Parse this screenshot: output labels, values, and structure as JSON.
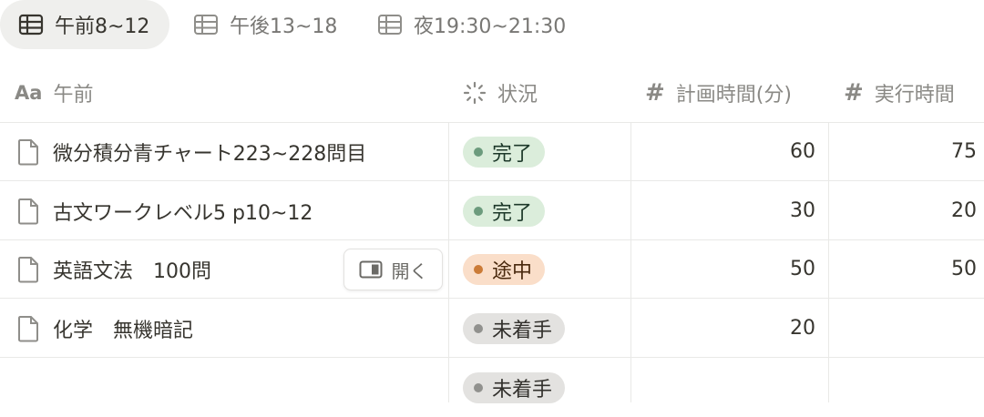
{
  "tabs": [
    {
      "label": "午前8~12",
      "active": true,
      "icon": "table-icon"
    },
    {
      "label": "午後13~18",
      "active": false,
      "icon": "table-icon"
    },
    {
      "label": "夜19:30~21:30",
      "active": false,
      "icon": "table-icon"
    }
  ],
  "columns": {
    "title": {
      "label": "午前",
      "icon_text": "Aa"
    },
    "status": {
      "label": "状況",
      "icon": "status-spinner-icon"
    },
    "planned": {
      "label": "計画時間(分)",
      "icon_text": "#"
    },
    "actual": {
      "label": "実行時間",
      "icon_text": "#"
    }
  },
  "rows": [
    {
      "title": "微分積分青チャート223~228問目",
      "status": "完了",
      "status_kind": "done",
      "planned": "60",
      "actual": "75"
    },
    {
      "title": "古文ワークレベル5 p10~12",
      "status": "完了",
      "status_kind": "done",
      "planned": "30",
      "actual": "20"
    },
    {
      "title": "英語文法　100問",
      "status": "途中",
      "status_kind": "in-progress",
      "planned": "50",
      "actual": "50"
    },
    {
      "title": "化学　無機暗記",
      "status": "未着手",
      "status_kind": "not-started",
      "planned": "20",
      "actual": ""
    },
    {
      "title": "",
      "status": "未着手",
      "status_kind": "not-started",
      "planned": "",
      "actual": ""
    }
  ],
  "open_button": {
    "label": "開く",
    "icon": "side-peek-icon"
  },
  "colors": {
    "done_bg": "#dbeddb",
    "done_dot": "#6c9b7d",
    "progress_bg": "#fadec9",
    "progress_dot": "#cb7b37",
    "todo_bg": "#e3e2e0",
    "todo_dot": "#91918e"
  }
}
